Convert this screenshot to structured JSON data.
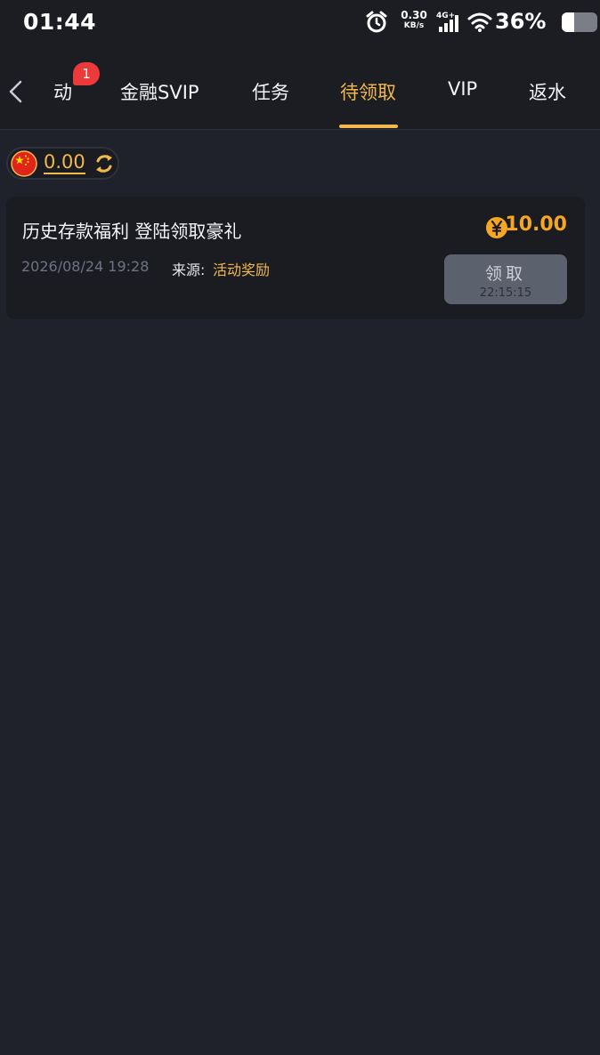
{
  "status_bar": {
    "time": "01:44",
    "net_speed_value": "0.30",
    "net_speed_unit": "KB/s",
    "network_type": "4G+",
    "battery_percent": "36%",
    "battery_level": 0.36,
    "icons": [
      "alarm-icon",
      "signal-icon",
      "wifi-icon",
      "battery-icon"
    ]
  },
  "tabs": {
    "items": [
      {
        "label": "动",
        "badge": "1"
      },
      {
        "label": "金融SVIP"
      },
      {
        "label": "任务"
      },
      {
        "label": "待领取",
        "active": true
      },
      {
        "label": "VIP"
      },
      {
        "label": "返水"
      }
    ]
  },
  "wallet": {
    "balance": "0.00",
    "currency_flag": "china-flag-icon"
  },
  "rewards": [
    {
      "title": "历史存款福利 登陆领取豪礼",
      "amount": "10.00",
      "date": "2026/08/24 19:28",
      "source_label": "来源:",
      "source_value": "活动奖励",
      "button_label": "领取",
      "countdown": "22:15:15"
    }
  ],
  "colors": {
    "accent": "#f2b84b",
    "amount": "#f5a623",
    "background": "#1f222b",
    "card": "#1a1c22",
    "badge": "#ec3a3a"
  }
}
